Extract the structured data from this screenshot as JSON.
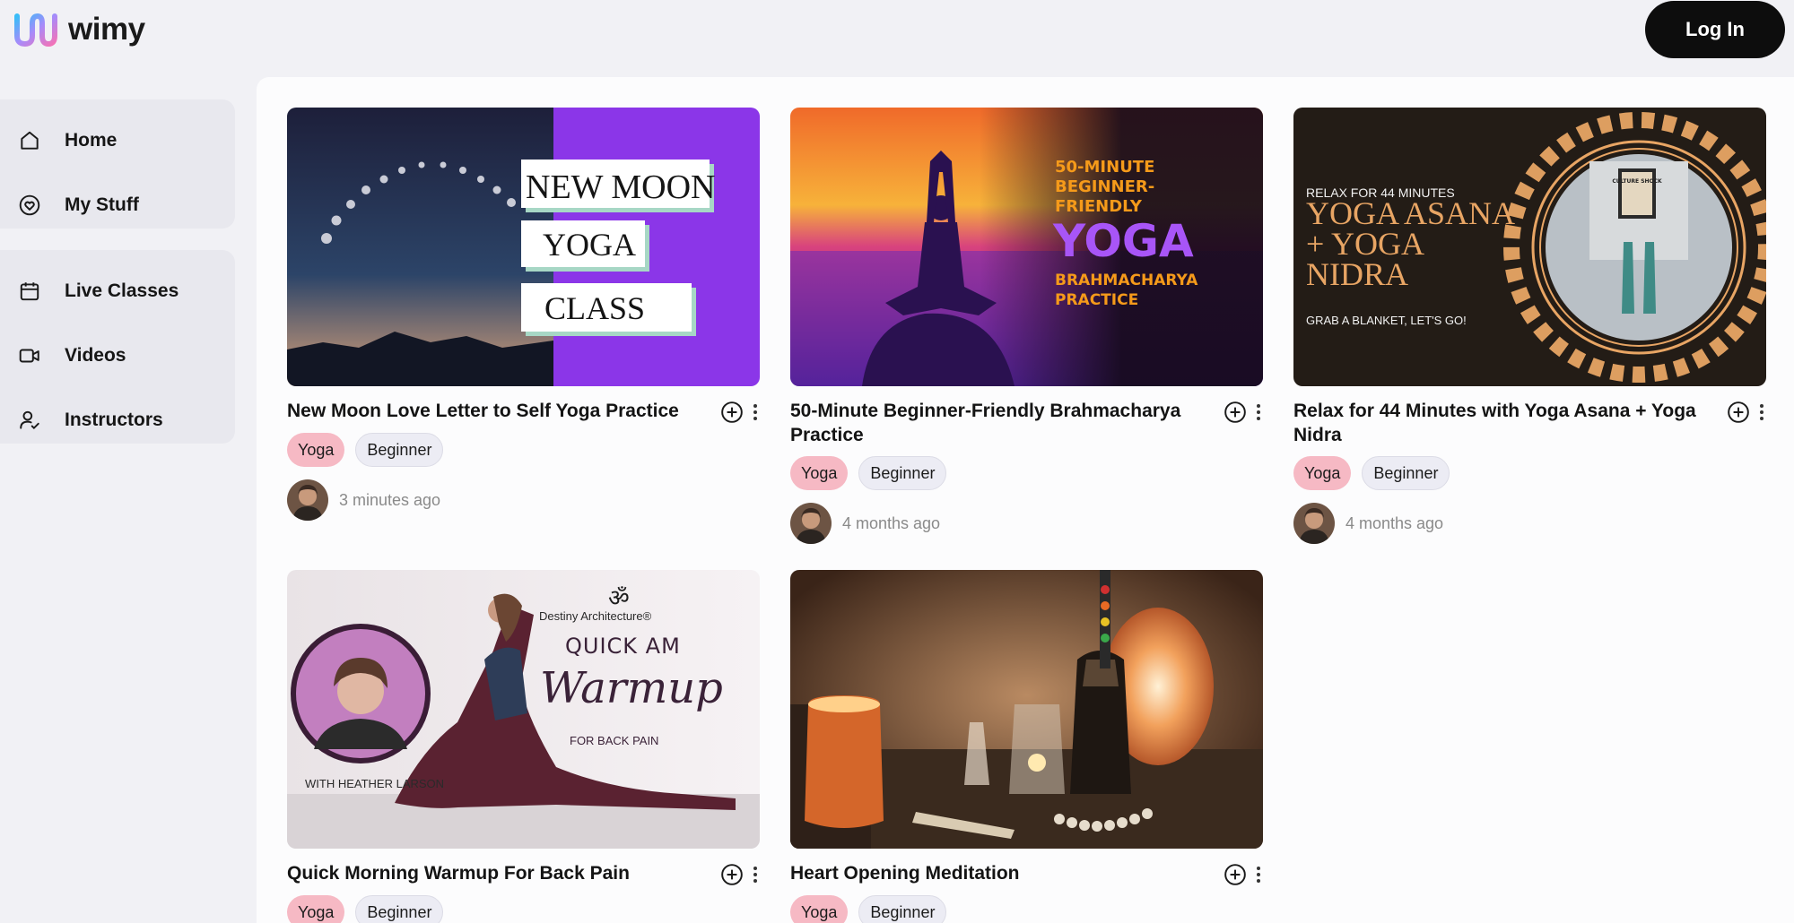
{
  "header": {
    "logo_text": "wimy",
    "login_label": "Log In"
  },
  "sidebar": {
    "group1": [
      {
        "label": "Home",
        "icon": "home-icon"
      },
      {
        "label": "My Stuff",
        "icon": "heart-icon"
      }
    ],
    "group2": [
      {
        "label": "Live Classes",
        "icon": "calendar-icon"
      },
      {
        "label": "Videos",
        "icon": "video-camera-icon"
      },
      {
        "label": "Instructors",
        "icon": "user-check-icon"
      }
    ]
  },
  "cards": [
    {
      "title": "New Moon Love Letter to Self Yoga Practice",
      "tags": [
        "Yoga",
        "Beginner"
      ],
      "time": "3 minutes ago",
      "thumb": {
        "lines": [
          "NEW MOON",
          "YOGA",
          "CLASS"
        ]
      }
    },
    {
      "title": "50-Minute Beginner-Friendly Brahmacharya Practice",
      "tags": [
        "Yoga",
        "Beginner"
      ],
      "time": "4 months ago",
      "thumb": {
        "lines": [
          "50-MINUTE",
          "BEGINNER-",
          "FRIENDLY",
          "YOGA",
          "BRAHMACHARYA",
          "PRACTICE"
        ]
      }
    },
    {
      "title": "Relax for 44 Minutes with Yoga Asana + Yoga Nidra",
      "tags": [
        "Yoga",
        "Beginner"
      ],
      "time": "4 months ago",
      "thumb": {
        "lines": [
          "RELAX FOR 44 MINUTES",
          "YOGA ASANA",
          "+ YOGA",
          "NIDRA",
          "GRAB A BLANKET, LET'S GO!",
          "CULTURE SHOCK"
        ]
      }
    },
    {
      "title": "Quick Morning Warmup For Back Pain",
      "tags": [
        "Yoga",
        "Beginner"
      ],
      "thumb": {
        "lines": [
          "ॐ",
          "Destiny Architecture®",
          "QUICK AM",
          "Warmup",
          "FOR BACK PAIN",
          "WITH HEATHER LARSON"
        ]
      }
    },
    {
      "title": "Heart Opening Meditation",
      "tags": [
        "Yoga",
        "Beginner"
      ],
      "thumb": {
        "lines": []
      }
    }
  ],
  "colors": {
    "accent_dark": "#0d0d0d",
    "yoga_tag": "#f6b9c4",
    "level_tag": "#ececf4",
    "purple": "#9333ea"
  }
}
